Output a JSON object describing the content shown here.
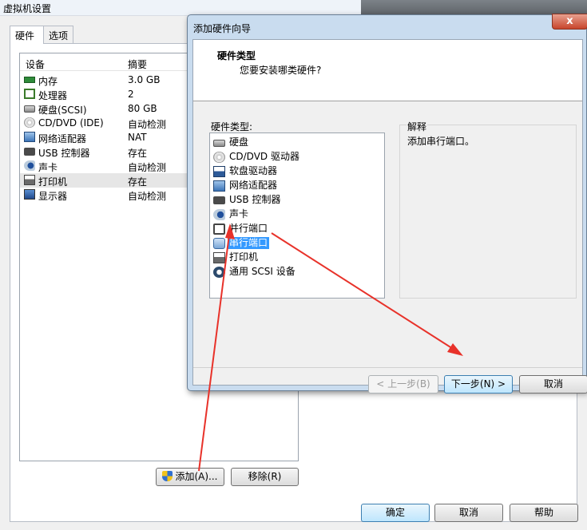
{
  "background_window": {
    "title": "虚拟机设置",
    "tabs": [
      {
        "label": "硬件",
        "active": true
      },
      {
        "label": "选项",
        "active": false
      }
    ],
    "columns": {
      "device": "设备",
      "summary": "摘要"
    },
    "devices": [
      {
        "name": "内存",
        "summary": "3.0 GB",
        "icon": "memory-icon"
      },
      {
        "name": "处理器",
        "summary": "2",
        "icon": "processor-icon"
      },
      {
        "name": "硬盘(SCSI)",
        "summary": "80 GB",
        "icon": "hard-disk-icon"
      },
      {
        "name": "CD/DVD (IDE)",
        "summary": "自动检测",
        "icon": "cd-dvd-icon"
      },
      {
        "name": "网络适配器",
        "summary": "NAT",
        "icon": "network-adapter-icon"
      },
      {
        "name": "USB 控制器",
        "summary": "存在",
        "icon": "usb-icon"
      },
      {
        "name": "声卡",
        "summary": "自动检测",
        "icon": "sound-card-icon"
      },
      {
        "name": "打印机",
        "summary": "存在",
        "icon": "printer-icon"
      },
      {
        "name": "显示器",
        "summary": "自动检测",
        "icon": "display-icon"
      }
    ],
    "selected_index": 7,
    "buttons": {
      "add": "添加(A)...",
      "remove": "移除(R)",
      "ok": "确定",
      "cancel": "取消",
      "help": "帮助"
    }
  },
  "wizard": {
    "title": "添加硬件向导",
    "close_glyph": "x",
    "header_title": "硬件类型",
    "header_subtitle": "您要安装哪类硬件?",
    "list_label": "硬件类型:",
    "items": [
      {
        "label": "硬盘",
        "icon": "hard-disk-icon"
      },
      {
        "label": "CD/DVD 驱动器",
        "icon": "cd-dvd-icon"
      },
      {
        "label": "软盘驱动器",
        "icon": "floppy-icon"
      },
      {
        "label": "网络适配器",
        "icon": "network-adapter-icon"
      },
      {
        "label": "USB 控制器",
        "icon": "usb-icon"
      },
      {
        "label": "声卡",
        "icon": "sound-card-icon"
      },
      {
        "label": "并行端口",
        "icon": "parallel-port-icon"
      },
      {
        "label": "串行端口",
        "icon": "serial-port-icon"
      },
      {
        "label": "打印机",
        "icon": "printer-icon"
      },
      {
        "label": "通用 SCSI 设备",
        "icon": "scsi-device-icon"
      }
    ],
    "selected_index": 7,
    "explanation_title": "解释",
    "explanation_text": "添加串行端口。",
    "buttons": {
      "back": "< 上一步(B)",
      "next": "下一步(N) >",
      "cancel": "取消"
    }
  },
  "colors": {
    "selection": "#3399ff",
    "annotation_arrow": "#e8322a",
    "primary_button": "#3c7fb1"
  }
}
